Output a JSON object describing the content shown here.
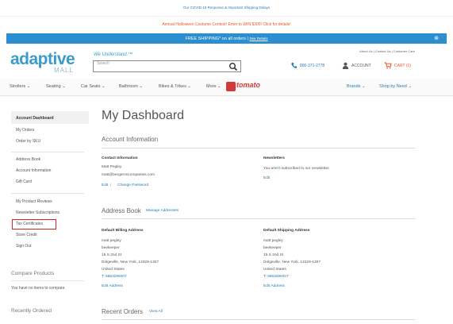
{
  "promo": {
    "covid": "Our COVID-19 Response & Important Shipping Delays",
    "contest": "Annual Halloween Costume Contest! Enter to WIN $300! Click for details!"
  },
  "shipping": {
    "text": "FREE SHIPPING* on all orders |",
    "details": "See Details"
  },
  "header": {
    "logo": "adaptive",
    "logo_sub": "MALL",
    "tagline": "We Understand.™",
    "search_placeholder": "Search",
    "top_links": "About Us  |  Contact Us  |  Customer Care",
    "phone": "800-371-2778",
    "account": "ACCOUNT",
    "cart": "CART (1)"
  },
  "nav": {
    "items": [
      "Strollers ⌄",
      "Seating ⌄",
      "Car Seats ⌄",
      "Bathroom ⌄",
      "Bikes & Trikes ⌄",
      "More ⌄"
    ],
    "brand": "tomato",
    "brands": "Brands ⌄",
    "shop_by_need": "Shop by Need ⌄"
  },
  "sidebar": {
    "items": [
      "Account Dashboard",
      "My Orders",
      "Order by SKU",
      "Address Book",
      "Account Information",
      "Gift Card",
      "My Product Reviews",
      "Newsletter Subscriptions",
      "Tax Certificates",
      "Store Credit",
      "Sign Out"
    ],
    "compare_title": "Compare Products",
    "compare_text": "You have no items to compare.",
    "recent_title": "Recently Ordered"
  },
  "main": {
    "title": "My Dashboard",
    "account_info": "Account Information",
    "contact_label": "Contact Information",
    "contact_name": "Matt Pegley",
    "contact_email": "matt@bergeroncompanies.com",
    "edit": "Edit",
    "change_password": "Change Password",
    "newsletters_label": "Newsletters",
    "newsletters_text": "You aren't subscribed to our newsletter.",
    "address_book": "Address Book",
    "manage_addresses": "Manage Addresses",
    "billing_label": "Default Billing Address",
    "shipping_label": "Default Shipping Address",
    "billing": [
      "matt pegley",
      "beekeeper",
      "15 S 2nd St",
      "Dolgeville, New York, 13329-1307",
      "United States"
    ],
    "billing_phone": "T: 5853298407",
    "shipping_addr": [
      "matt pegley",
      "beekeeper",
      "15 S 2nd St",
      "Dolgeville, New York, 13329-1307",
      "United States"
    ],
    "shipping_phone": "T: 5853298407",
    "edit_address": "Edit Address",
    "recent_orders": "Recent Orders",
    "view_all": "View All"
  }
}
